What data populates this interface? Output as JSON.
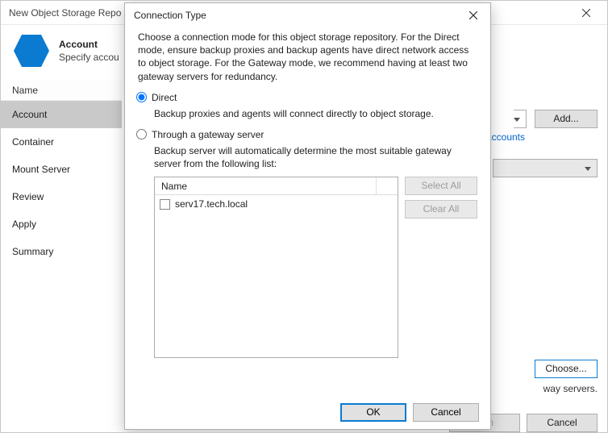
{
  "window": {
    "title": "New Object Storage Repo"
  },
  "page": {
    "title": "Account",
    "subtitle": "Specify accou"
  },
  "nav": {
    "header": "Name",
    "items": [
      "Account",
      "Container",
      "Mount Server",
      "Review",
      "Apply",
      "Summary"
    ],
    "selectedIndex": 0
  },
  "right": {
    "add": "Add...",
    "hyperlink_fragment": "accounts",
    "choose": "Choose...",
    "gateway_text_fragment": "way servers.",
    "finish": "nish",
    "cancel": "Cancel"
  },
  "dialog": {
    "title": "Connection Type",
    "description": "Choose a connection mode for this object storage repository. For the Direct mode, ensure backup proxies and backup agents have direct network access to object storage. For the Gateway mode, we recommend having at least two gateway servers for redundancy.",
    "direct": {
      "label": "Direct",
      "sub": "Backup proxies and agents will connect directly to object storage.",
      "selected": true
    },
    "gateway": {
      "label": "Through a gateway server",
      "sub": "Backup server will automatically determine the most suitable gateway server from the following list:",
      "selected": false
    },
    "list": {
      "column": "Name",
      "items": [
        {
          "label": "serv17.tech.local",
          "checked": false
        }
      ]
    },
    "buttons": {
      "select_all": "Select All",
      "clear_all": "Clear All",
      "ok": "OK",
      "cancel": "Cancel"
    }
  }
}
